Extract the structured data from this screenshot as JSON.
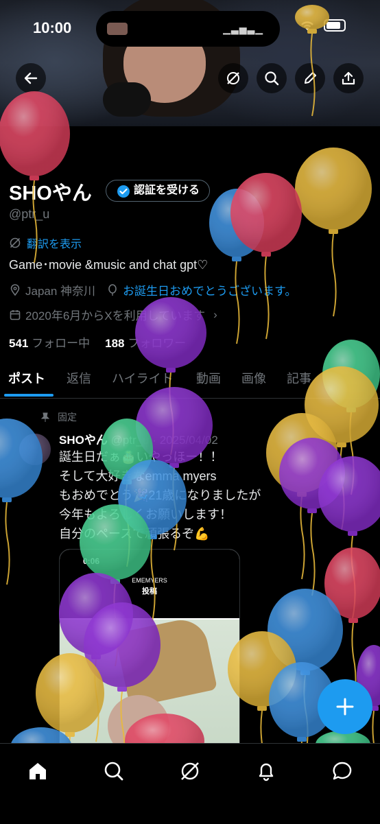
{
  "status_bar": {
    "time": "10:00"
  },
  "profile": {
    "name": "SHOやん",
    "verify_label": "認証を受ける",
    "handle": "@ptr_u",
    "translate_label": "翻訳を表示",
    "bio": "Game･movie &music and chat gpt♡",
    "location": "Japan  神奈川",
    "birthday_text": "お誕生日おめでとうございます。",
    "joined": "2020年6月からXを利用しています",
    "following_count": "541",
    "following_label": "フォロー中",
    "followers_count": "188",
    "followers_label": "フォロワー"
  },
  "tabs": [
    "ポスト",
    "返信",
    "ハイライト",
    "動画",
    "画像",
    "記事"
  ],
  "post": {
    "pinned_label": "固定",
    "author": "SHOやん",
    "meta": "@ptr_u · 2025/04/02",
    "lines": [
      "誕生日だぁ🎂いやっほー！！",
      "そして大好きなemma myers",
      "もおめでとう🎉21歳になりましたが",
      "今年もよろしくお願いします！",
      "自分のペースで頑張るぞ💪"
    ],
    "embed": {
      "time": "0:06",
      "title": "EMEMYERS",
      "subtitle": "投稿"
    }
  },
  "colors": {
    "accent": "#1d9bf0",
    "background": "#000000",
    "muted": "#71767b",
    "text": "#e7e9ea"
  },
  "icons": [
    "back-arrow-icon",
    "grok-icon",
    "search-icon",
    "edit-icon",
    "share-icon",
    "verified-badge-icon",
    "translate-icon",
    "location-icon",
    "balloon-icon",
    "calendar-icon",
    "pin-icon",
    "plus-icon",
    "home-icon",
    "bell-icon",
    "messages-icon"
  ]
}
